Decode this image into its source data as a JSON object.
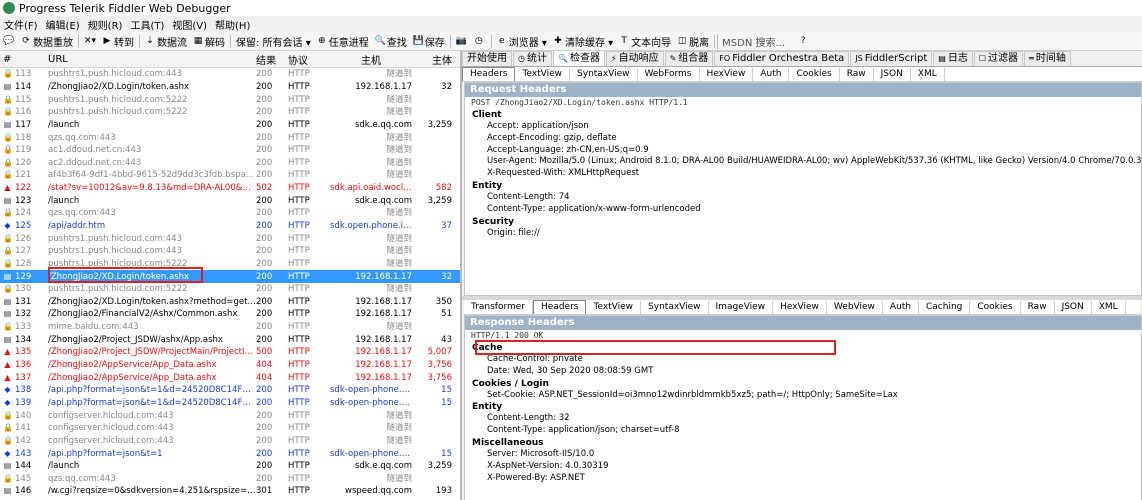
{
  "title": "Progress Telerik Fiddler Web Debugger",
  "menu": [
    "文件(F)",
    "编辑(E)",
    "规则(R)",
    "工具(T)",
    "视图(V)",
    "帮助(H)"
  ],
  "toolbar": [
    {
      "icon": "comment-icon",
      "label": "",
      "glyph": "💬"
    },
    {
      "icon": "replay-icon",
      "label": "数据重放",
      "glyph": "⟳"
    },
    {
      "icon": "remove-icon",
      "label": "",
      "glyph": "✕▾"
    },
    {
      "icon": "go-icon",
      "label": "转到",
      "glyph": "▶"
    },
    {
      "icon": "stream-icon",
      "label": "数据流",
      "glyph": "⇣"
    },
    {
      "icon": "decode-icon",
      "label": "解码",
      "glyph": "▦"
    },
    {
      "icon": "keep-icon",
      "label": "保留: 所有会话 ▾",
      "glyph": ""
    },
    {
      "icon": "target-icon",
      "label": "任意进程",
      "glyph": "⊕"
    },
    {
      "icon": "find-icon",
      "label": "查找",
      "glyph": "🔍"
    },
    {
      "icon": "save-icon",
      "label": "保存",
      "glyph": "💾"
    },
    {
      "icon": "screenshot-icon",
      "label": "",
      "glyph": "📷"
    },
    {
      "icon": "timer-icon",
      "label": "",
      "glyph": "◷"
    },
    {
      "icon": "browse-icon",
      "label": "浏览器 ▾",
      "glyph": "e"
    },
    {
      "icon": "clear-cache-icon",
      "label": "清除缓存 ▾",
      "glyph": "✚"
    },
    {
      "icon": "text-wizard-icon",
      "label": "文本向导",
      "glyph": "T"
    },
    {
      "icon": "tearoff-icon",
      "label": "脱离",
      "glyph": "◫"
    },
    {
      "icon": "search-box",
      "label": "MSDN 搜索...",
      "glyph": ""
    },
    {
      "icon": "help-icon",
      "label": "",
      "glyph": "?"
    }
  ],
  "sessions": {
    "columns": [
      "#",
      "URL",
      "结果",
      "协议",
      "主机",
      "主体"
    ],
    "rows": [
      {
        "num": "113",
        "url": "pushtrs1.push.hicloud.com:443",
        "result": "200",
        "proto": "HTTP",
        "host": "隧道到",
        "body": "",
        "style": "grey",
        "icon": "lock"
      },
      {
        "num": "114",
        "url": "/ZhongJiao2/XD.Login/token.ashx",
        "result": "200",
        "proto": "HTTP",
        "host": "192.168.1.17",
        "body": "32",
        "style": "black",
        "icon": "doc"
      },
      {
        "num": "115",
        "url": "pushtrs1.push.hicloud.com:5222",
        "result": "200",
        "proto": "HTTP",
        "host": "隧道到",
        "body": "",
        "style": "grey",
        "icon": "lock"
      },
      {
        "num": "116",
        "url": "pushtrs1.push.hicloud.com:5222",
        "result": "200",
        "proto": "HTTP",
        "host": "隧道到",
        "body": "",
        "style": "grey",
        "icon": "lock"
      },
      {
        "num": "117",
        "url": "/launch",
        "result": "200",
        "proto": "HTTP",
        "host": "sdk.e.qq.com",
        "body": "3,259",
        "style": "black",
        "icon": "doc"
      },
      {
        "num": "118",
        "url": "qzs.qq.com:443",
        "result": "200",
        "proto": "HTTP",
        "host": "隧道到",
        "body": "",
        "style": "grey",
        "icon": "lock"
      },
      {
        "num": "119",
        "url": "ac1.ddoud.net.cn:443",
        "result": "200",
        "proto": "HTTP",
        "host": "隧道到",
        "body": "",
        "style": "grey",
        "icon": "lock"
      },
      {
        "num": "120",
        "url": "ac2.ddoud.net.cn:443",
        "result": "200",
        "proto": "HTTP",
        "host": "隧道到",
        "body": "",
        "style": "grey",
        "icon": "lock"
      },
      {
        "num": "121",
        "url": "af4b3f64-9df1-4bbd-9615-52d9dd3c3fdb.bspapp.c...",
        "result": "200",
        "proto": "HTTP",
        "host": "隧道到",
        "body": "",
        "style": "grey",
        "icon": "lock"
      },
      {
        "num": "122",
        "url": "/stat?sv=10012&av=9.8.13&md=DRA-AL00&mf=...",
        "result": "502",
        "proto": "HTTP",
        "host": "sdk.api.oaid.woclou...",
        "body": "582",
        "style": "red",
        "icon": "warn"
      },
      {
        "num": "123",
        "url": "/launch",
        "result": "200",
        "proto": "HTTP",
        "host": "sdk.e.qq.com",
        "body": "3,259",
        "style": "black",
        "icon": "doc"
      },
      {
        "num": "124",
        "url": "qzs.qq.com:443",
        "result": "200",
        "proto": "HTTP",
        "host": "隧道到",
        "body": "",
        "style": "grey",
        "icon": "lock"
      },
      {
        "num": "125",
        "url": "/api/addr.htm",
        "result": "200",
        "proto": "HTTP",
        "host": "sdk.open.phone.ige...",
        "body": "37",
        "style": "blue",
        "icon": "arrows"
      },
      {
        "num": "126",
        "url": "pushtrs1.push.hicloud.com:443",
        "result": "200",
        "proto": "HTTP",
        "host": "隧道到",
        "body": "",
        "style": "grey",
        "icon": "lock"
      },
      {
        "num": "127",
        "url": "pushtrs1.push.hicloud.com:443",
        "result": "200",
        "proto": "HTTP",
        "host": "隧道到",
        "body": "",
        "style": "grey",
        "icon": "lock"
      },
      {
        "num": "128",
        "url": "pushtrs1.push.hicloud.com:5222",
        "result": "200",
        "proto": "HTTP",
        "host": "隧道到",
        "body": "",
        "style": "grey",
        "icon": "lock"
      },
      {
        "num": "129",
        "url": "/ZhongJiao2/XD.Login/token.ashx",
        "result": "200",
        "proto": "HTTP",
        "host": "192.168.1.17",
        "body": "32",
        "style": "sel",
        "icon": "doc"
      },
      {
        "num": "130",
        "url": "pushtrs1.push.hicloud.com:5222",
        "result": "200",
        "proto": "HTTP",
        "host": "隧道到",
        "body": "",
        "style": "grey",
        "icon": "lock"
      },
      {
        "num": "131",
        "url": "/ZhongJiao2/XD.Login/token.ashx?method=get_to...",
        "result": "200",
        "proto": "HTTP",
        "host": "192.168.1.17",
        "body": "350",
        "style": "black",
        "icon": "doc"
      },
      {
        "num": "132",
        "url": "/ZhongJiao2/FinancialV2/Ashx/Common.ashx",
        "result": "200",
        "proto": "HTTP",
        "host": "192.168.1.17",
        "body": "51",
        "style": "black",
        "icon": "doc"
      },
      {
        "num": "133",
        "url": "mime.baidu.com:443",
        "result": "200",
        "proto": "HTTP",
        "host": "隧道到",
        "body": "",
        "style": "grey",
        "icon": "lock"
      },
      {
        "num": "134",
        "url": "/ZhongJiao2/Project_JSDW/ashx/App.ashx",
        "result": "200",
        "proto": "HTTP",
        "host": "192.168.1.17",
        "body": "43",
        "style": "black",
        "icon": "doc"
      },
      {
        "num": "135",
        "url": "/ZhongJiao2/Project_JSDW/ProjectMain/ProjectInf...",
        "result": "500",
        "proto": "HTTP",
        "host": "192.168.1.17",
        "body": "5,007",
        "style": "red",
        "icon": "warn"
      },
      {
        "num": "136",
        "url": "/ZhongJiao2/AppService/App_Data.ashx",
        "result": "404",
        "proto": "HTTP",
        "host": "192.168.1.17",
        "body": "3,756",
        "style": "red",
        "icon": "warn"
      },
      {
        "num": "137",
        "url": "/ZhongJiao2/AppService/App_Data.ashx",
        "result": "404",
        "proto": "HTTP",
        "host": "192.168.1.17",
        "body": "3,756",
        "style": "red",
        "icon": "warn"
      },
      {
        "num": "138",
        "url": "/api.php?format=json&t=1&d=24520D8C14F7A74...",
        "result": "200",
        "proto": "HTTP",
        "host": "sdk-open-phone.ge...",
        "body": "15",
        "style": "blue",
        "icon": "arrows"
      },
      {
        "num": "139",
        "url": "/api.php?format=json&t=1&d=24520D8C14F7A74...",
        "result": "200",
        "proto": "HTTP",
        "host": "sdk-open-phone.ge...",
        "body": "15",
        "style": "blue",
        "icon": "arrows"
      },
      {
        "num": "140",
        "url": "configserver.hicloud.com:443",
        "result": "200",
        "proto": "HTTP",
        "host": "隧道到",
        "body": "",
        "style": "grey",
        "icon": "lock"
      },
      {
        "num": "141",
        "url": "configserver.hicloud.com:443",
        "result": "200",
        "proto": "HTTP",
        "host": "隧道到",
        "body": "",
        "style": "grey",
        "icon": "lock"
      },
      {
        "num": "142",
        "url": "configserver.hicloud.com:443",
        "result": "200",
        "proto": "HTTP",
        "host": "隧道到",
        "body": "",
        "style": "grey",
        "icon": "lock"
      },
      {
        "num": "143",
        "url": "/api.php?format=json&t=1",
        "result": "200",
        "proto": "HTTP",
        "host": "sdk-open-phone.ge...",
        "body": "15",
        "style": "blue",
        "icon": "arrows"
      },
      {
        "num": "144",
        "url": "/launch",
        "result": "200",
        "proto": "HTTP",
        "host": "sdk.e.qq.com",
        "body": "3,259",
        "style": "black",
        "icon": "doc"
      },
      {
        "num": "145",
        "url": "qzs.qq.com:443",
        "result": "200",
        "proto": "HTTP",
        "host": "隧道到",
        "body": "",
        "style": "grey",
        "icon": "lock"
      },
      {
        "num": "146",
        "url": "/w.cgi?reqsize=0&sdkversion=4.251&rspsize=0&t...",
        "result": "301",
        "proto": "HTTP",
        "host": "wspeed.qq.com",
        "body": "193",
        "style": "black",
        "icon": "doc"
      }
    ]
  },
  "tabs_top": [
    {
      "label": "开始使用",
      "glyph": ""
    },
    {
      "label": "统计",
      "glyph": "◷"
    },
    {
      "label": "检查器",
      "glyph": "🔍"
    },
    {
      "label": "自动响应",
      "glyph": "⚡"
    },
    {
      "label": "组合器",
      "glyph": "✎"
    },
    {
      "label": "Fiddler Orchestra Beta",
      "glyph": "FO"
    },
    {
      "label": "FiddlerScript",
      "glyph": "JS"
    },
    {
      "label": "日志",
      "glyph": "▤"
    },
    {
      "label": "过滤器",
      "glyph": "☐"
    },
    {
      "label": "时间轴",
      "glyph": "═"
    }
  ],
  "request_tabs": [
    "Headers",
    "TextView",
    "SyntaxView",
    "WebForms",
    "HexView",
    "Auth",
    "Cookies",
    "Raw",
    "JSON",
    "XML"
  ],
  "request": {
    "header_title": "Request Headers",
    "first_line": "POST /ZhongJiao2/XD.Login/token.ashx HTTP/1.1",
    "sections": [
      {
        "name": "Client",
        "items": [
          "Accept: application/json",
          "Accept-Encoding: gzip, deflate",
          "Accept-Language: zh-CN,en-US;q=0.9",
          "User-Agent: Mozilla/5.0 (Linux; Android 8.1.0; DRA-AL00 Build/HUAWEIDRA-AL00; wv) AppleWebKit/537.36 (KHTML, like Gecko) Version/4.0 Chrome/70.0.3538.110 Mobile Safari/537.36",
          "X-Requested-With: XMLHttpRequest"
        ]
      },
      {
        "name": "Entity",
        "items": [
          "Content-Length: 74",
          "Content-Type: application/x-www-form-urlencoded"
        ]
      },
      {
        "name": "Security",
        "items": [
          "Origin: file://"
        ]
      }
    ]
  },
  "response_tabs": [
    "Transformer",
    "Headers",
    "TextView",
    "SyntaxView",
    "ImageView",
    "HexView",
    "WebView",
    "Auth",
    "Caching",
    "Cookies",
    "Raw",
    "JSON",
    "XML"
  ],
  "response": {
    "header_title": "Response Headers",
    "first_line": "HTTP/1.1 200 OK",
    "sections": [
      {
        "name": "Cache",
        "items": [
          "Cache-Control: private",
          "Date: Wed, 30 Sep 2020 08:08:59 GMT"
        ]
      },
      {
        "name": "Cookies / Login",
        "items": [
          "Set-Cookie: ASP.NET_SessionId=oi3mno12wdinrbldmmkb5xz5; path=/; HttpOnly; SameSite=Lax"
        ]
      },
      {
        "name": "Entity",
        "items": [
          "Content-Length: 32",
          "Content-Type: application/json; charset=utf-8"
        ]
      },
      {
        "name": "Miscellaneous",
        "items": [
          "Server: Microsoft-IIS/10.0",
          "X-AspNet-Version: 4.0.30319",
          "X-Powered-By: ASP.NET"
        ]
      }
    ]
  },
  "colors": {
    "selected": "#3399ff",
    "error": "#e01010",
    "link": "#1a3bd6",
    "tunnel": "#8a8a8a",
    "header_band": "#9fb3c8",
    "highlight": "#e02020"
  }
}
